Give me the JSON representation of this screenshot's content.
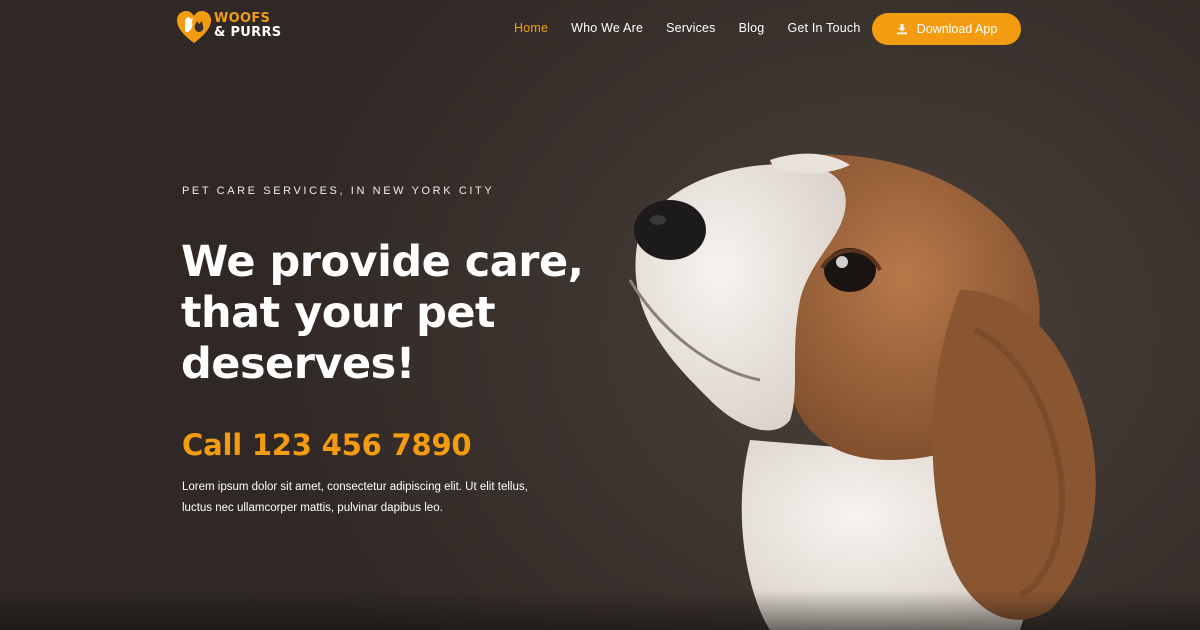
{
  "brand": {
    "line1": "WOOFS",
    "line2": "& PURRS",
    "accent": "#f39c12"
  },
  "nav": {
    "items": [
      {
        "label": "Home",
        "active": true
      },
      {
        "label": "Who We Are",
        "active": false
      },
      {
        "label": "Services",
        "active": false
      },
      {
        "label": "Blog",
        "active": false
      },
      {
        "label": "Get In Touch",
        "active": false
      }
    ]
  },
  "cta": {
    "label": "Download App",
    "icon": "download-icon"
  },
  "hero": {
    "eyebrow": "PET CARE SERVICES, IN NEW YORK CITY",
    "headline_1": "We provide care,",
    "headline_2": "that your pet",
    "headline_3": "deserves!",
    "phone": "Call 123 456 7890",
    "body_1": "Lorem ipsum dolor sit amet, consectetur adipiscing elit. Ut elit tellus,",
    "body_2": "luctus nec ullamcorper mattis, pulvinar dapibus leo.",
    "image": "beagle-puppy-photo"
  },
  "colors": {
    "background": "#3a312d",
    "accent": "#f39c12",
    "text": "#ffffff"
  }
}
